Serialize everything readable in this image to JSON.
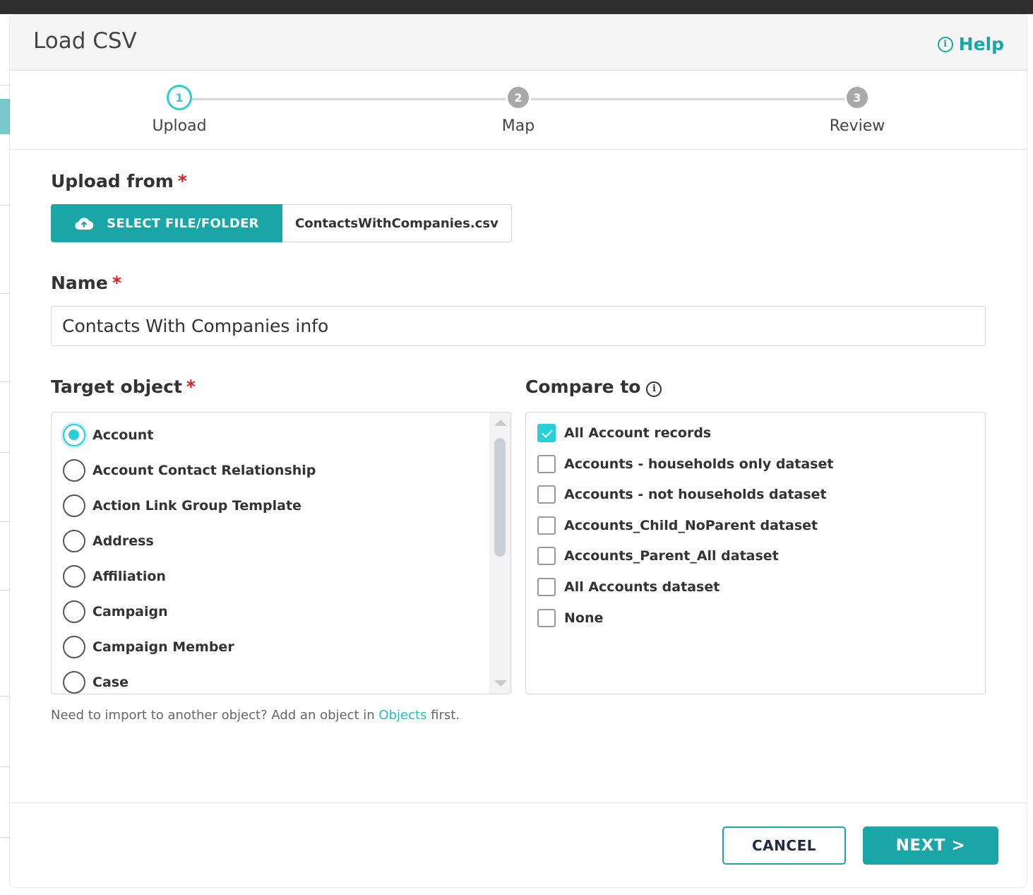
{
  "modal": {
    "title": "Load CSV",
    "help_label": "Help"
  },
  "steps": [
    {
      "number": "1",
      "label": "Upload",
      "state": "active"
    },
    {
      "number": "2",
      "label": "Map",
      "state": "pending"
    },
    {
      "number": "3",
      "label": "Review",
      "state": "pending"
    }
  ],
  "upload": {
    "label": "Upload from",
    "required_mark": "*",
    "button_label": "SELECT FILE/FOLDER",
    "file_name": "ContactsWithCompanies.csv"
  },
  "name": {
    "label": "Name",
    "required_mark": "*",
    "value": "Contacts With Companies info"
  },
  "target_object": {
    "label": "Target object",
    "required_mark": "*",
    "selected": "Account",
    "options": [
      "Account",
      "Account Contact Relationship",
      "Action Link Group Template",
      "Address",
      "Affiliation",
      "Campaign",
      "Campaign Member",
      "Case"
    ]
  },
  "compare_to": {
    "label": "Compare to",
    "options": [
      {
        "label": "All Account records",
        "checked": true
      },
      {
        "label": "Accounts - households only dataset",
        "checked": false
      },
      {
        "label": "Accounts - not households dataset",
        "checked": false
      },
      {
        "label": "Accounts_Child_NoParent dataset",
        "checked": false
      },
      {
        "label": "Accounts_Parent_All dataset",
        "checked": false
      },
      {
        "label": "All Accounts dataset",
        "checked": false
      },
      {
        "label": "None",
        "checked": false
      }
    ]
  },
  "hint": {
    "before": "Need to import to another object? Add an object in ",
    "link": "Objects",
    "after": " first."
  },
  "footer": {
    "cancel_label": "CANCEL",
    "next_label": "NEXT >"
  },
  "colors": {
    "accent": "#1aa6a6",
    "active_step": "#28cfd6",
    "required": "#e01b1b"
  }
}
